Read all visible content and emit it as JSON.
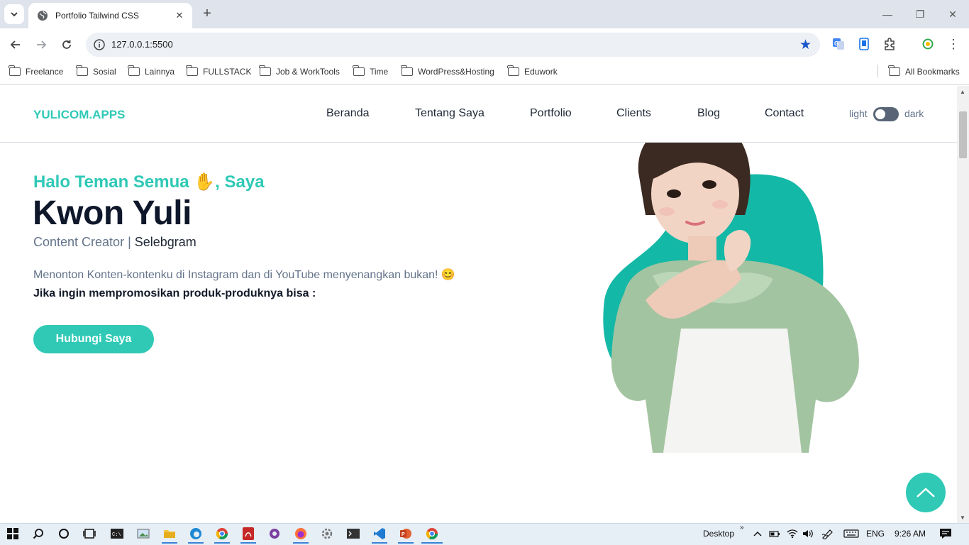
{
  "browser": {
    "tab_title": "Portfolio Tailwind CSS",
    "url": "127.0.0.1:5500",
    "bookmarks": [
      "Freelance",
      "Sosial",
      "Lainnya",
      "FULLSTACK",
      "Job & WorkTools",
      "Time",
      "WordPress&Hosting",
      "Eduwork"
    ],
    "all_bookmarks": "All Bookmarks"
  },
  "site": {
    "brand": "YULICOM.APPS",
    "nav": [
      "Beranda",
      "Tentang Saya",
      "Portfolio",
      "Clients",
      "Blog",
      "Contact"
    ],
    "theme_light": "light",
    "theme_dark": "dark"
  },
  "hero": {
    "greeting": "Halo Teman Semua ✋, Saya",
    "name": "Kwon Yuli",
    "role_prefix": "Content Creator | ",
    "role_highlight": "Selebgram",
    "description": "Menonton Konten-kontenku di Instagram dan di YouTube menyenangkan bukan! 😊",
    "description_bold": "Jika ingin mempromosikan produk-produknya bisa :",
    "cta": "Hubungi Saya"
  },
  "taskbar": {
    "desktop_label": "Desktop",
    "language": "ENG",
    "time": "9:26 AM"
  },
  "colors": {
    "accent": "#2fc9b6",
    "blob": "#14b8a6",
    "heading": "#0f172a",
    "muted": "#64748b"
  }
}
